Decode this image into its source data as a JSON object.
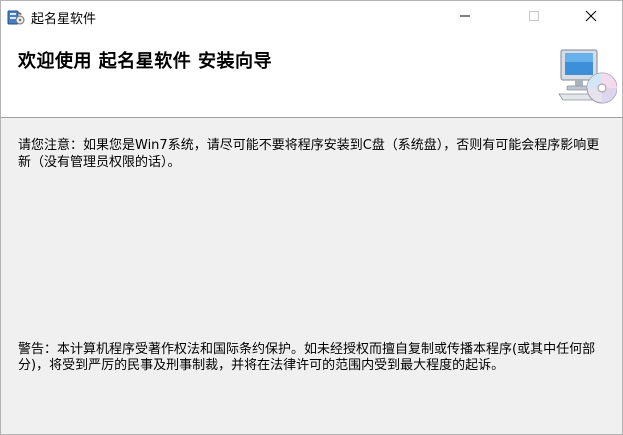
{
  "window": {
    "title": "起名星软件",
    "icons": {
      "app": "installer-app-icon",
      "minimize": "minimize-icon",
      "maximize": "maximize-icon",
      "close": "close-icon",
      "header": "computer-with-cd-icon"
    }
  },
  "header": {
    "title": "欢迎使用 起名星软件 安装向导"
  },
  "body": {
    "notice": "请您注意：如果您是Win7系统，请尽可能不要将程序安装到C盘（系统盘），否则有可能会程序影响更新（没有管理员权限的话）。",
    "warning": "警告：本计算机程序受著作权法和国际条约保护。如未经授权而擅自复制或传播本程序(或其中任何部分)，将受到严厉的民事及刑事制裁，并将在法律许可的范围内受到最大程度的起诉。"
  }
}
